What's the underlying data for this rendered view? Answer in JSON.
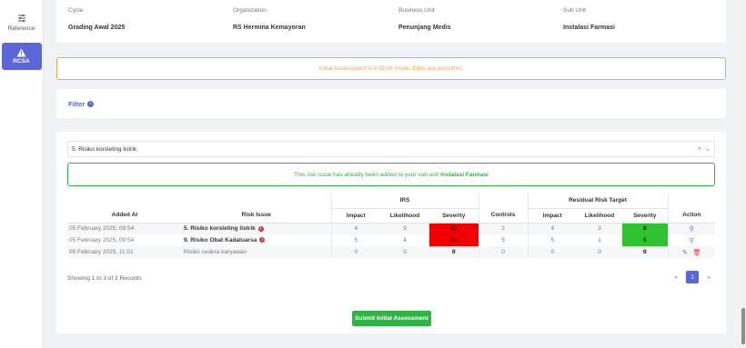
{
  "sidebar": {
    "reference_label": "Reference",
    "rcsa_label": "RCSA"
  },
  "info": {
    "cycle": {
      "label": "Cycle",
      "value": "Grading Awal 2025"
    },
    "organization": {
      "label": "Organization",
      "value": "RS Hermina Kemayoran"
    },
    "business_unit": {
      "label": "Business Unit",
      "value": "Penunjang Medis"
    },
    "sub_unit": {
      "label": "Sub Unit",
      "value": "Instalasi Farmasi"
    }
  },
  "draft_alert": "Initial Assessment is in Draft mode. Edits are permitted.",
  "filter_label": "Filter",
  "risk_select": {
    "value": "5. Risiko korsleting listrik"
  },
  "success_alert": {
    "text": "This risk issue has already been added to your sub unit",
    "unit": "Instalasi Farmasi"
  },
  "table": {
    "group_headers": {
      "irs": "IRS",
      "residual": "Residual Risk Target"
    },
    "columns": {
      "added_at": "Added At",
      "risk_issue": "Risk Issue",
      "impact": "Impact",
      "likelihood": "Likelihood",
      "severity": "Severity",
      "controls": "Controls",
      "r_impact": "Impact",
      "r_likelihood": "Likelihood",
      "r_severity": "Severity",
      "action": "Action"
    },
    "rows": [
      {
        "added_at": "05 February 2025, 09:54",
        "risk_issue": "5. Risiko korsleting listrik",
        "impact": "4",
        "likelihood": "5",
        "severity": "20",
        "controls": "2",
        "r_impact": "4",
        "r_likelihood": "2",
        "r_severity": "8"
      },
      {
        "added_at": "05 February 2025, 09:54",
        "risk_issue": "9. Risiko Obat Kadaluarsa",
        "impact": "5",
        "likelihood": "4",
        "severity": "20",
        "controls": "5",
        "r_impact": "5",
        "r_likelihood": "1",
        "r_severity": "5"
      },
      {
        "added_at": "05 February 2025, 11:01",
        "risk_issue": "Risiko cedera karyawan",
        "impact": "0",
        "likelihood": "0",
        "severity": "0",
        "controls": "0",
        "r_impact": "0",
        "r_likelihood": "0",
        "r_severity": "0"
      }
    ]
  },
  "showing_text": "Showing 1 to 3 of 3 Records",
  "pager": {
    "prev": "«",
    "current": "1",
    "next": "»"
  },
  "submit_label": "Submit Initial Assessment",
  "colors": {
    "accent": "#5b67d8",
    "success": "#2fb344",
    "warning": "#f5a54a",
    "danger": "#f20000"
  }
}
